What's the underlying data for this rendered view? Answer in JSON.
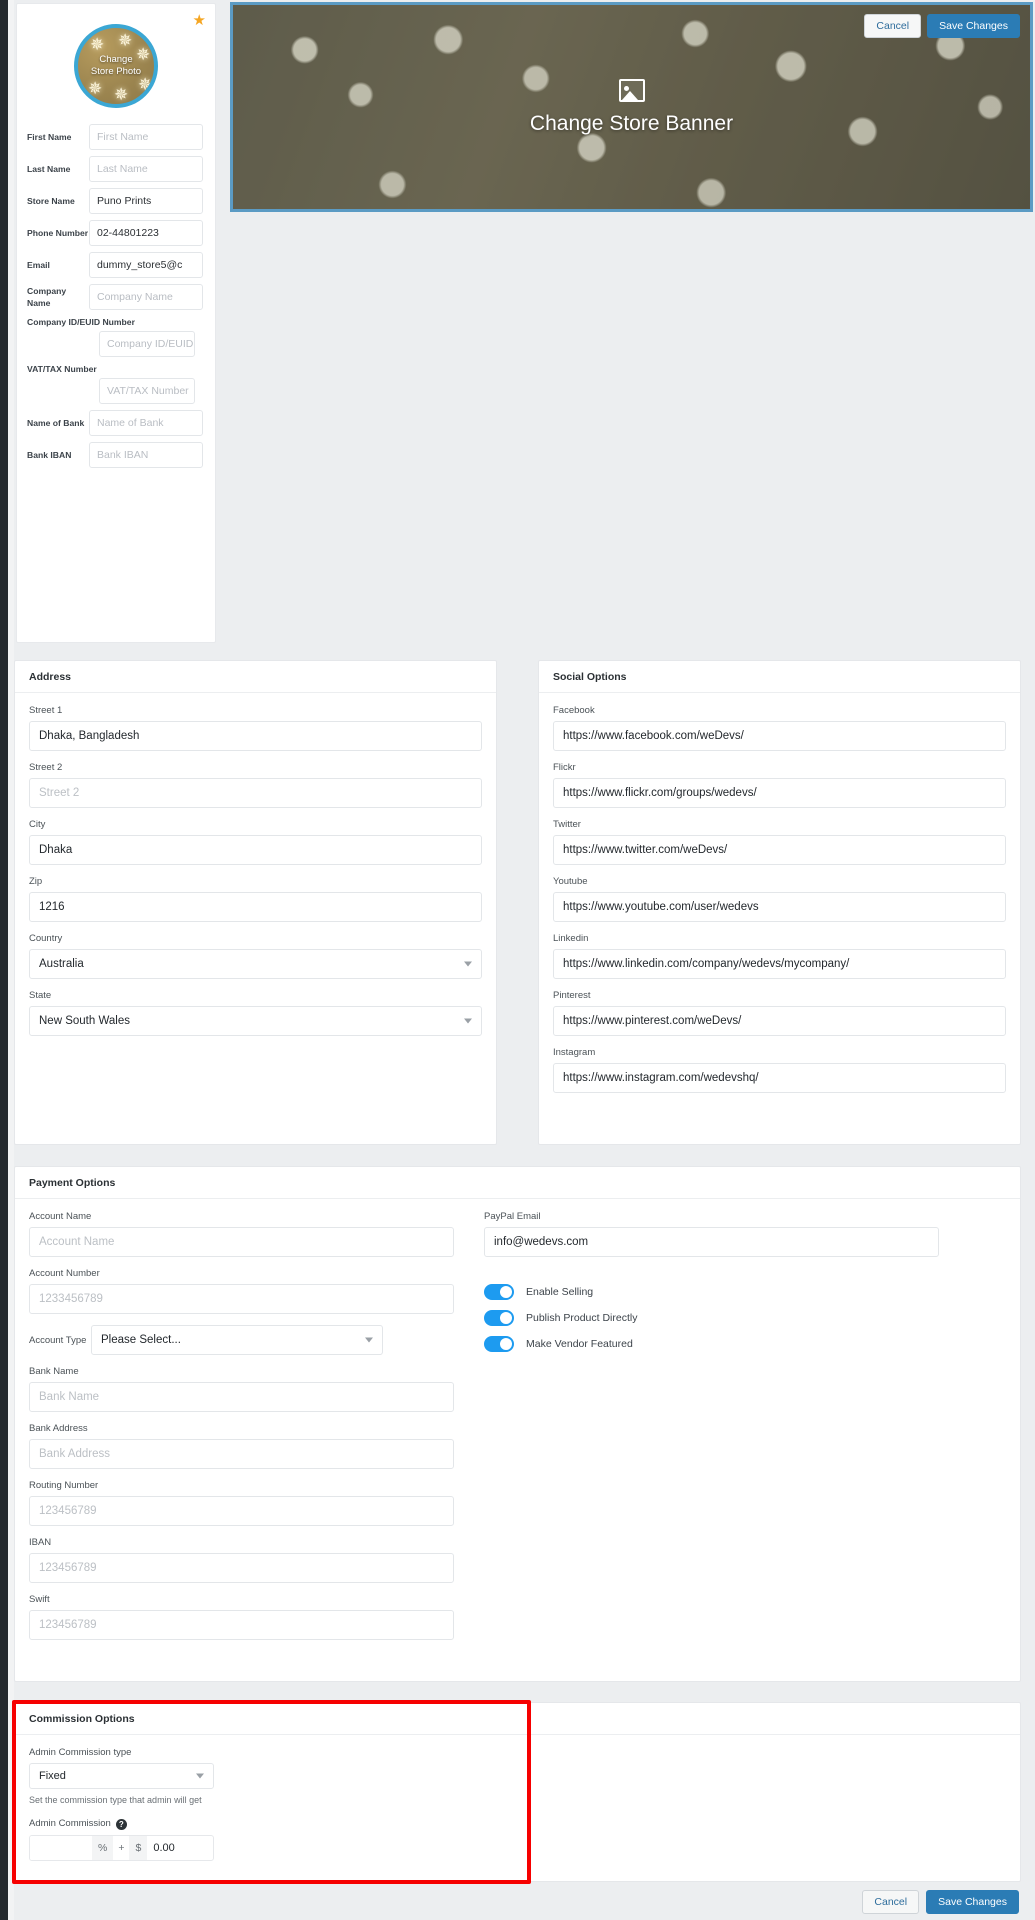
{
  "profile": {
    "star_icon": "star-icon",
    "avatar_label_line1": "Change",
    "avatar_label_line2": "Store Photo",
    "fields": [
      {
        "label": "First Name",
        "value": "",
        "placeholder": "First Name",
        "stacked": false
      },
      {
        "label": "Last Name",
        "value": "",
        "placeholder": "Last Name",
        "stacked": false
      },
      {
        "label": "Store Name",
        "value": "Puno Prints",
        "placeholder": "Store Name",
        "stacked": false
      },
      {
        "label": "Phone Number",
        "value": "02-44801223",
        "placeholder": "Phone Number",
        "stacked": false
      },
      {
        "label": "Email",
        "value": "dummy_store5@c",
        "placeholder": "Email",
        "stacked": false
      },
      {
        "label": "Company Name",
        "value": "",
        "placeholder": "Company Name",
        "stacked": false
      },
      {
        "label": "Company ID/EUID Number",
        "value": "",
        "placeholder": "Company ID/EUID",
        "stacked": true
      },
      {
        "label": "VAT/TAX Number",
        "value": "",
        "placeholder": "VAT/TAX Number",
        "stacked": true
      },
      {
        "label": "Name of Bank",
        "value": "",
        "placeholder": "Name of Bank",
        "stacked": false
      },
      {
        "label": "Bank IBAN",
        "value": "",
        "placeholder": "Bank IBAN",
        "stacked": false
      }
    ]
  },
  "banner": {
    "icon": "image-placeholder-icon",
    "text": "Change Store Banner",
    "cancel_label": "Cancel",
    "save_label": "Save Changes"
  },
  "address": {
    "title": "Address",
    "fields": [
      {
        "label": "Street 1",
        "value": "Dhaka, Bangladesh",
        "placeholder": "Street 1",
        "type": "text"
      },
      {
        "label": "Street 2",
        "value": "",
        "placeholder": "Street 2",
        "type": "text"
      },
      {
        "label": "City",
        "value": "Dhaka",
        "placeholder": "City",
        "type": "text"
      },
      {
        "label": "Zip",
        "value": "1216",
        "placeholder": "Zip",
        "type": "text"
      },
      {
        "label": "Country",
        "value": "Australia",
        "placeholder": "",
        "type": "select"
      },
      {
        "label": "State",
        "value": "New South Wales",
        "placeholder": "",
        "type": "select"
      }
    ]
  },
  "social": {
    "title": "Social Options",
    "fields": [
      {
        "label": "Facebook",
        "value": "https://www.facebook.com/weDevs/"
      },
      {
        "label": "Flickr",
        "value": "https://www.flickr.com/groups/wedevs/"
      },
      {
        "label": "Twitter",
        "value": "https://www.twitter.com/weDevs/"
      },
      {
        "label": "Youtube",
        "value": "https://www.youtube.com/user/wedevs"
      },
      {
        "label": "Linkedin",
        "value": "https://www.linkedin.com/company/wedevs/mycompany/"
      },
      {
        "label": "Pinterest",
        "value": "https://www.pinterest.com/weDevs/"
      },
      {
        "label": "Instagram",
        "value": "https://www.instagram.com/wedevshq/"
      }
    ]
  },
  "payment": {
    "title": "Payment Options",
    "left_fields": [
      {
        "label": "Account Name",
        "value": "",
        "placeholder": "Account Name"
      },
      {
        "label": "Account Number",
        "value": "",
        "placeholder": "1233456789"
      }
    ],
    "account_type": {
      "label": "Account Type",
      "value": "Please Select..."
    },
    "left_fields_2": [
      {
        "label": "Bank Name",
        "value": "",
        "placeholder": "Bank Name"
      },
      {
        "label": "Bank Address",
        "value": "",
        "placeholder": "Bank Address"
      },
      {
        "label": "Routing Number",
        "value": "",
        "placeholder": "123456789"
      },
      {
        "label": "IBAN",
        "value": "",
        "placeholder": "123456789"
      },
      {
        "label": "Swift",
        "value": "",
        "placeholder": "123456789"
      }
    ],
    "paypal": {
      "label": "PayPal Email",
      "value": "info@wedevs.com",
      "placeholder": "PayPal Email"
    },
    "toggles": [
      {
        "label": "Enable Selling",
        "on": true
      },
      {
        "label": "Publish Product Directly",
        "on": true
      },
      {
        "label": "Make Vendor Featured",
        "on": true
      }
    ]
  },
  "commission": {
    "title": "Commission Options",
    "type_label": "Admin Commission type",
    "type_value": "Fixed",
    "type_description": "Set the commission type that admin will get",
    "amount_label": "Admin Commission",
    "help_icon": "question-mark-icon",
    "percent_value": "",
    "percent_symbol": "%",
    "plus_symbol": "+",
    "currency_symbol": "$",
    "fixed_value": "0.00",
    "highlight_color": "#f60000"
  },
  "footer": {
    "cancel_label": "Cancel",
    "save_label": "Save Changes"
  },
  "theme": {
    "accent": "#2b7cb5",
    "toggle_on": "#1d9bf0",
    "star": "#f5a623",
    "page_bg": "#eceef0"
  }
}
